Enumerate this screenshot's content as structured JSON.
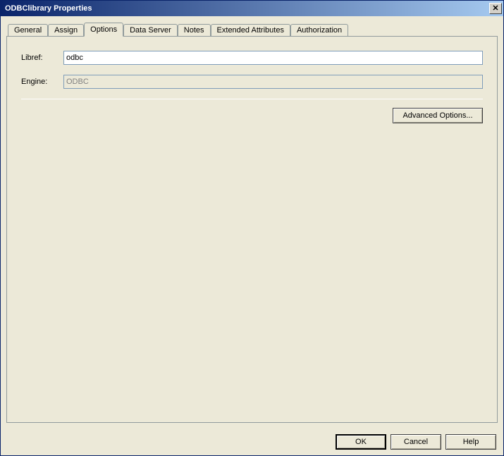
{
  "window": {
    "title": "ODBClibrary Properties"
  },
  "tabs": {
    "general": "General",
    "assign": "Assign",
    "options": "Options",
    "data_server": "Data Server",
    "notes": "Notes",
    "extended_attributes": "Extended Attributes",
    "authorization": "Authorization"
  },
  "options": {
    "libref_label": "Libref:",
    "libref_value": "odbc",
    "engine_label": "Engine:",
    "engine_value": "ODBC",
    "advanced_button": "Advanced Options..."
  },
  "buttons": {
    "ok": "OK",
    "cancel": "Cancel",
    "help": "Help"
  }
}
